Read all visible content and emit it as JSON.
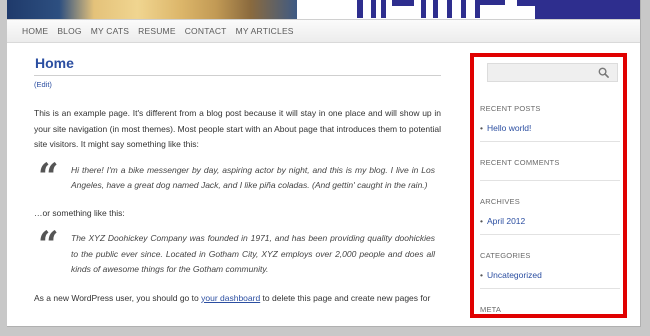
{
  "header": {
    "banner_colors": {
      "dark": "#2e2e8e",
      "gold": "#e4c27a"
    }
  },
  "nav": {
    "items": [
      "HOME",
      "BLOG",
      "MY CATS",
      "RESUME",
      "CONTACT",
      "MY ARTICLES"
    ]
  },
  "page": {
    "title": "Home",
    "edit_label": "(Edit)",
    "intro": "This is an example page. It's different from a blog post because it will stay in one place and will show up in your site navigation (in most themes). Most people start with an About page that introduces them to potential site visitors. It might say something like this:",
    "quote1": "Hi there! I'm a bike messenger by day, aspiring actor by night, and this is my blog. I live in Los Angeles, have a great dog named Jack, and I like piña coladas. (And gettin' caught in the rain.)",
    "or_text": "…or something like this:",
    "quote2": "The XYZ Doohickey Company was founded in 1971, and has been providing quality doohickies to the public ever since. Located in Gotham City, XYZ employs over 2,000 people and does all kinds of awesome things for the Gotham community.",
    "outro_before": "As a new WordPress user, you should go to ",
    "outro_link": "your dashboard",
    "outro_after": " to delete this page and create new pages for"
  },
  "sidebar": {
    "search_icon": "magnifier",
    "highlight_color": "#e00000",
    "recent_posts": {
      "heading": "RECENT POSTS",
      "items": [
        "Hello world!"
      ]
    },
    "recent_comments": {
      "heading": "RECENT COMMENTS"
    },
    "archives": {
      "heading": "ARCHIVES",
      "items": [
        "April 2012"
      ]
    },
    "categories": {
      "heading": "CATEGORIES",
      "items": [
        "Uncategorized"
      ]
    },
    "meta": {
      "heading": "META"
    }
  }
}
